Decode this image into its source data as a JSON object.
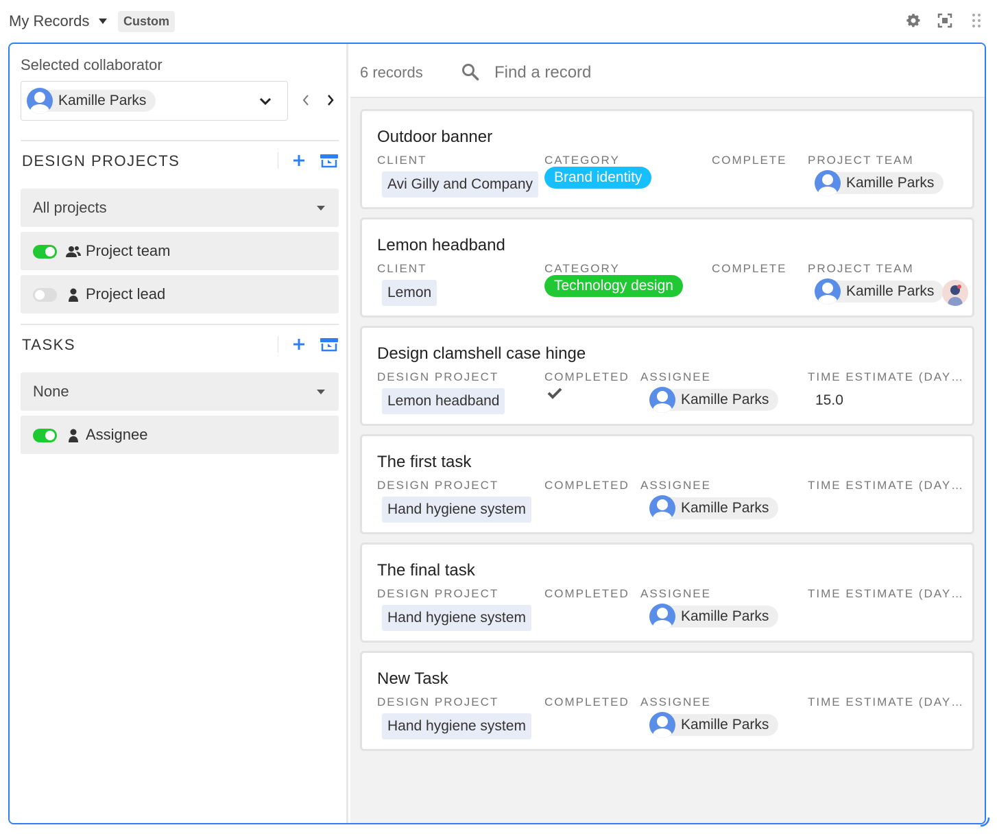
{
  "header": {
    "view_title": "My Records",
    "custom_badge": "Custom",
    "icons": [
      "gear-icon",
      "expand-icon",
      "drag-handle-icon"
    ]
  },
  "sidebar": {
    "selected_label": "Selected collaborator",
    "collaborator": "Kamille Parks",
    "sections": [
      {
        "title": "DESIGN PROJECTS",
        "dropdown": "All projects",
        "toggles": [
          {
            "label": "Project team",
            "on": true,
            "icon": "people-icon"
          },
          {
            "label": "Project lead",
            "on": false,
            "icon": "person-icon"
          }
        ]
      },
      {
        "title": "TASKS",
        "dropdown": "None",
        "toggles": [
          {
            "label": "Assignee",
            "on": true,
            "icon": "person-icon"
          }
        ]
      }
    ]
  },
  "main": {
    "record_count": "6 records",
    "search_placeholder": "Find a record",
    "field_labels": {
      "client": "CLIENT",
      "category": "CATEGORY",
      "complete": "COMPLETE",
      "project_team": "PROJECT TEAM",
      "design_project": "DESIGN PROJECT",
      "completed": "COMPLETED",
      "assignee": "ASSIGNEE",
      "time_estimate": "TIME ESTIMATE (DAY…"
    },
    "records": [
      {
        "title": "Outdoor banner",
        "client": "Avi Gilly and Company",
        "category": "Brand identity",
        "category_color": "#18bfff",
        "team": "Kamille Parks"
      },
      {
        "title": "Lemon headband",
        "client": "Lemon",
        "category": "Technology design",
        "category_color": "#20c933",
        "team": "Kamille Parks"
      },
      {
        "title": "Design clamshell case hinge",
        "project": "Lemon headband",
        "completed": true,
        "assignee": "Kamille Parks",
        "estimate": "15.0"
      },
      {
        "title": "The first task",
        "project": "Hand hygiene system",
        "completed": false,
        "assignee": "Kamille Parks",
        "estimate": ""
      },
      {
        "title": "The final task",
        "project": "Hand hygiene system",
        "completed": false,
        "assignee": "Kamille Parks",
        "estimate": ""
      },
      {
        "title": "New Task",
        "project": "Hand hygiene system",
        "completed": false,
        "assignee": "Kamille Parks",
        "estimate": ""
      }
    ]
  },
  "colors": {
    "accent": "#2d7ff9",
    "toggle_on": "#20c933",
    "avatar": "#5a8de8"
  }
}
